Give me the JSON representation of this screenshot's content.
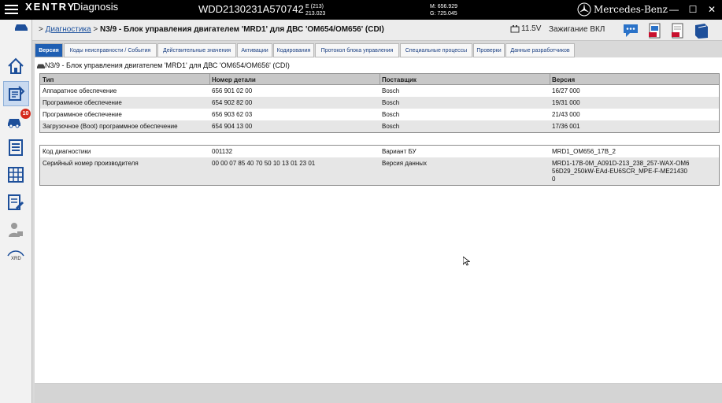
{
  "app": {
    "brand": "XENTRY",
    "name": "Diagnosis",
    "vin": "WDD2130231A570742",
    "e_code_line1": "E (213)",
    "e_code_line2": "213.023",
    "m_code": "M: 656.929",
    "g_code": "G: 725.045",
    "make": "Mercedes-Benz"
  },
  "sidebar": {
    "badge_count": "10",
    "xrd_label": "XRD"
  },
  "header": {
    "breadcrumb_root": "Диагностика",
    "breadcrumb_sep": ">",
    "breadcrumb_current": "N3/9 - Блок управления двигателем 'MRD1' для ДВС 'OM654/OM656' (CDI)",
    "battery": "11.5V",
    "ignition": "Зажигание ВКЛ"
  },
  "tabs": [
    {
      "label": "Версия",
      "active": true
    },
    {
      "label": "Коды неисправности / События",
      "active": false
    },
    {
      "label": "Действительные значения",
      "active": false
    },
    {
      "label": "Активации",
      "active": false
    },
    {
      "label": "Кодирования",
      "active": false
    },
    {
      "label": "Протокол блока управления",
      "active": false
    },
    {
      "label": "Специальные процессы",
      "active": false
    },
    {
      "label": "Проверки",
      "active": false
    },
    {
      "label": "Данные разработчиков",
      "active": false
    }
  ],
  "section_title": "N3/9 - Блок управления двигателем 'MRD1' для ДВС 'OM654/OM656' (CDI)",
  "version_table": {
    "headers": [
      "Тип",
      "Номер детали",
      "Поставщик",
      "Версия"
    ],
    "rows": [
      [
        "Аппаратное обеспечение",
        "656 901 02 00",
        "Bosch",
        "16/27 000"
      ],
      [
        "Программное обеспечение",
        "654 902 82 00",
        "Bosch",
        "19/31 000"
      ],
      [
        "Программное обеспечение",
        "656 903 62 03",
        "Bosch",
        "21/43 000"
      ],
      [
        "Загрузочное (Boot) программное обеспечение",
        "654 904 13 00",
        "Bosch",
        "17/36 001"
      ]
    ]
  },
  "info_table": {
    "rows": [
      [
        "Код диагностики",
        "001132",
        "Вариант БУ",
        "MRD1_OM656_17B_2"
      ],
      [
        "Серийный номер производителя",
        "00 00 07 85 40 70 50 10 13 01 23 01",
        "Версия данных",
        "MRD1-17B-0M_A091D-213_238_257-WAX-OM6",
        "56D29_250kW-EAd-EU6SCR_MPE-F-ME21430",
        "0"
      ]
    ]
  }
}
